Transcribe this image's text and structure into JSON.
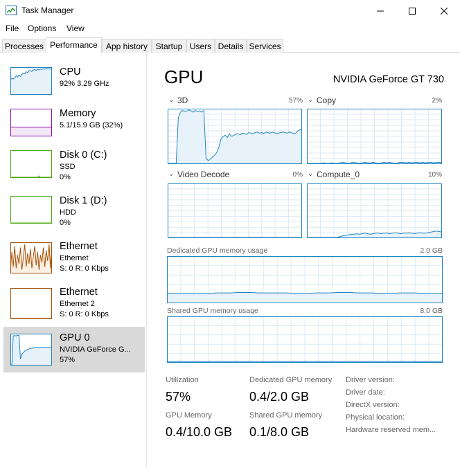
{
  "window": {
    "title": "Task Manager"
  },
  "menu": [
    "File",
    "Options",
    "View"
  ],
  "tabs": [
    "Processes",
    "Performance",
    "App history",
    "Startup",
    "Users",
    "Details",
    "Services"
  ],
  "active_tab": "Performance",
  "colors": {
    "cpu": "#1f85c4",
    "memory": "#8b12ae",
    "disk": "#4da60c",
    "ethernet": "#a74f01",
    "gpu": "#1f85c4",
    "selected": "#d9d9d9"
  },
  "sidebar": [
    {
      "name": "CPU",
      "lines": [
        "92%  3.29 GHz"
      ]
    },
    {
      "name": "Memory",
      "lines": [
        "5.1/15.9 GB (32%)"
      ]
    },
    {
      "name": "Disk 0 (C:)",
      "lines": [
        "SSD",
        "0%"
      ]
    },
    {
      "name": "Disk 1 (D:)",
      "lines": [
        "HDD",
        "0%"
      ]
    },
    {
      "name": "Ethernet",
      "lines": [
        "Ethernet",
        "S: 0  R: 0 Kbps"
      ]
    },
    {
      "name": "Ethernet",
      "lines": [
        "Ethernet 2",
        "S: 0  R: 0 Kbps"
      ]
    },
    {
      "name": "GPU 0",
      "lines": [
        "NVIDIA GeForce G...",
        "57%"
      ]
    }
  ],
  "main": {
    "title": "GPU",
    "device": "NVIDIA GeForce GT 730",
    "engines": [
      {
        "label": "3D",
        "pct": "57%"
      },
      {
        "label": "Copy",
        "pct": "2%"
      },
      {
        "label": "Video Decode",
        "pct": "0%"
      },
      {
        "label": "Compute_0",
        "pct": "10%"
      }
    ],
    "dedicated": {
      "label": "Dedicated GPU memory usage",
      "max": "2.0 GB"
    },
    "shared": {
      "label": "Shared GPU memory usage",
      "max": "8.0 GB"
    },
    "stats": {
      "utilization": {
        "label": "Utilization",
        "value": "57%"
      },
      "dedicated_mem": {
        "label": "Dedicated GPU memory",
        "value": "0.4/2.0 GB"
      },
      "gpu_memory": {
        "label": "GPU Memory",
        "value": "0.4/10.0 GB"
      },
      "shared_mem": {
        "label": "Shared GPU memory",
        "value": "0.1/8.0 GB"
      }
    },
    "info_labels": [
      "Driver version:",
      "Driver date:",
      "DirectX version:",
      "Physical location:",
      "Hardware reserved mem..."
    ]
  },
  "series": {
    "cpu_thumb": [
      55,
      60,
      58,
      62,
      70,
      65,
      72,
      68,
      75,
      80,
      78,
      85,
      82,
      88,
      90,
      86,
      92,
      94,
      90,
      95,
      92,
      96,
      94,
      97,
      95,
      98,
      96,
      97,
      95,
      96
    ],
    "memory_thumb": [
      32,
      32,
      32,
      33,
      32,
      32,
      32,
      32,
      32,
      32,
      33,
      32,
      32,
      32,
      32,
      32,
      32,
      32,
      32,
      32,
      32,
      32,
      32,
      32,
      32,
      32,
      32,
      32,
      32,
      32
    ],
    "eth1_thumb": [
      10,
      70,
      20,
      90,
      15,
      60,
      30,
      85,
      10,
      50,
      95,
      20,
      65,
      30,
      80,
      15,
      55,
      90,
      25,
      70,
      10,
      60,
      35,
      85,
      20,
      75,
      40,
      95,
      15,
      90
    ],
    "gpu_thumb": [
      0,
      0,
      95,
      96,
      95,
      97,
      96,
      20,
      35,
      40,
      45,
      48,
      50,
      52,
      55,
      54,
      56,
      57,
      58,
      57,
      56,
      57,
      58,
      57,
      57,
      58,
      57,
      56,
      57,
      57
    ],
    "gpu_3d": [
      0,
      0,
      0,
      0,
      0,
      85,
      95,
      98,
      96,
      97,
      99,
      97,
      95,
      98,
      96,
      97,
      95,
      98,
      10,
      5,
      8,
      12,
      15,
      20,
      30,
      45,
      50,
      52,
      48,
      55,
      50,
      52,
      54,
      55,
      53,
      56,
      55,
      54,
      57,
      56,
      55,
      57,
      58,
      56,
      57,
      55,
      58,
      57,
      56,
      58,
      57,
      55,
      56,
      57,
      58,
      57,
      56,
      58,
      57,
      55,
      56,
      60,
      62,
      63
    ],
    "gpu_copy": [
      0,
      0,
      0,
      0,
      0,
      0,
      1,
      0,
      0,
      1,
      0,
      0,
      1,
      2,
      1,
      0,
      1,
      2,
      1,
      0,
      1,
      2,
      1,
      1,
      2,
      1,
      0,
      1,
      2,
      1,
      2,
      1,
      0,
      1,
      2,
      2,
      1,
      2,
      1,
      2,
      2,
      1,
      2,
      1,
      2,
      2,
      1,
      2,
      2,
      2
    ],
    "gpu_decode": [
      0,
      0,
      0,
      0,
      0,
      0,
      0,
      0,
      0,
      0,
      0,
      0,
      0,
      0,
      0,
      0,
      0,
      0,
      0,
      0,
      0,
      0,
      0,
      0,
      0,
      0,
      0,
      0,
      0,
      0
    ],
    "gpu_compute": [
      0,
      0,
      0,
      0,
      0,
      0,
      0,
      0,
      0,
      0,
      0,
      0,
      2,
      3,
      4,
      5,
      6,
      6,
      7,
      6,
      7,
      8,
      7,
      6,
      7,
      8,
      8,
      7,
      8,
      8,
      7,
      8,
      9,
      8,
      7,
      8,
      8,
      9,
      8,
      7,
      8,
      9,
      8,
      8,
      9,
      10,
      11,
      12,
      11,
      10
    ],
    "mem_dedicated": [
      20,
      20,
      20,
      20,
      20,
      20,
      20,
      21,
      21,
      21,
      22,
      22,
      22,
      21,
      21,
      21,
      21,
      21,
      20,
      20,
      20,
      21,
      21,
      21,
      22,
      22,
      22,
      21,
      21,
      21,
      20,
      20,
      20,
      21,
      21,
      21,
      20,
      20,
      20,
      20
    ],
    "mem_shared": [
      1,
      1,
      1,
      1,
      1,
      1,
      1,
      1,
      1,
      1,
      1,
      1,
      1,
      1,
      1,
      1,
      1,
      1,
      1,
      1,
      1,
      1,
      1,
      1,
      1,
      1,
      1,
      1,
      1,
      1,
      1,
      1,
      1,
      1,
      1,
      1,
      1,
      1,
      1,
      1
    ]
  }
}
